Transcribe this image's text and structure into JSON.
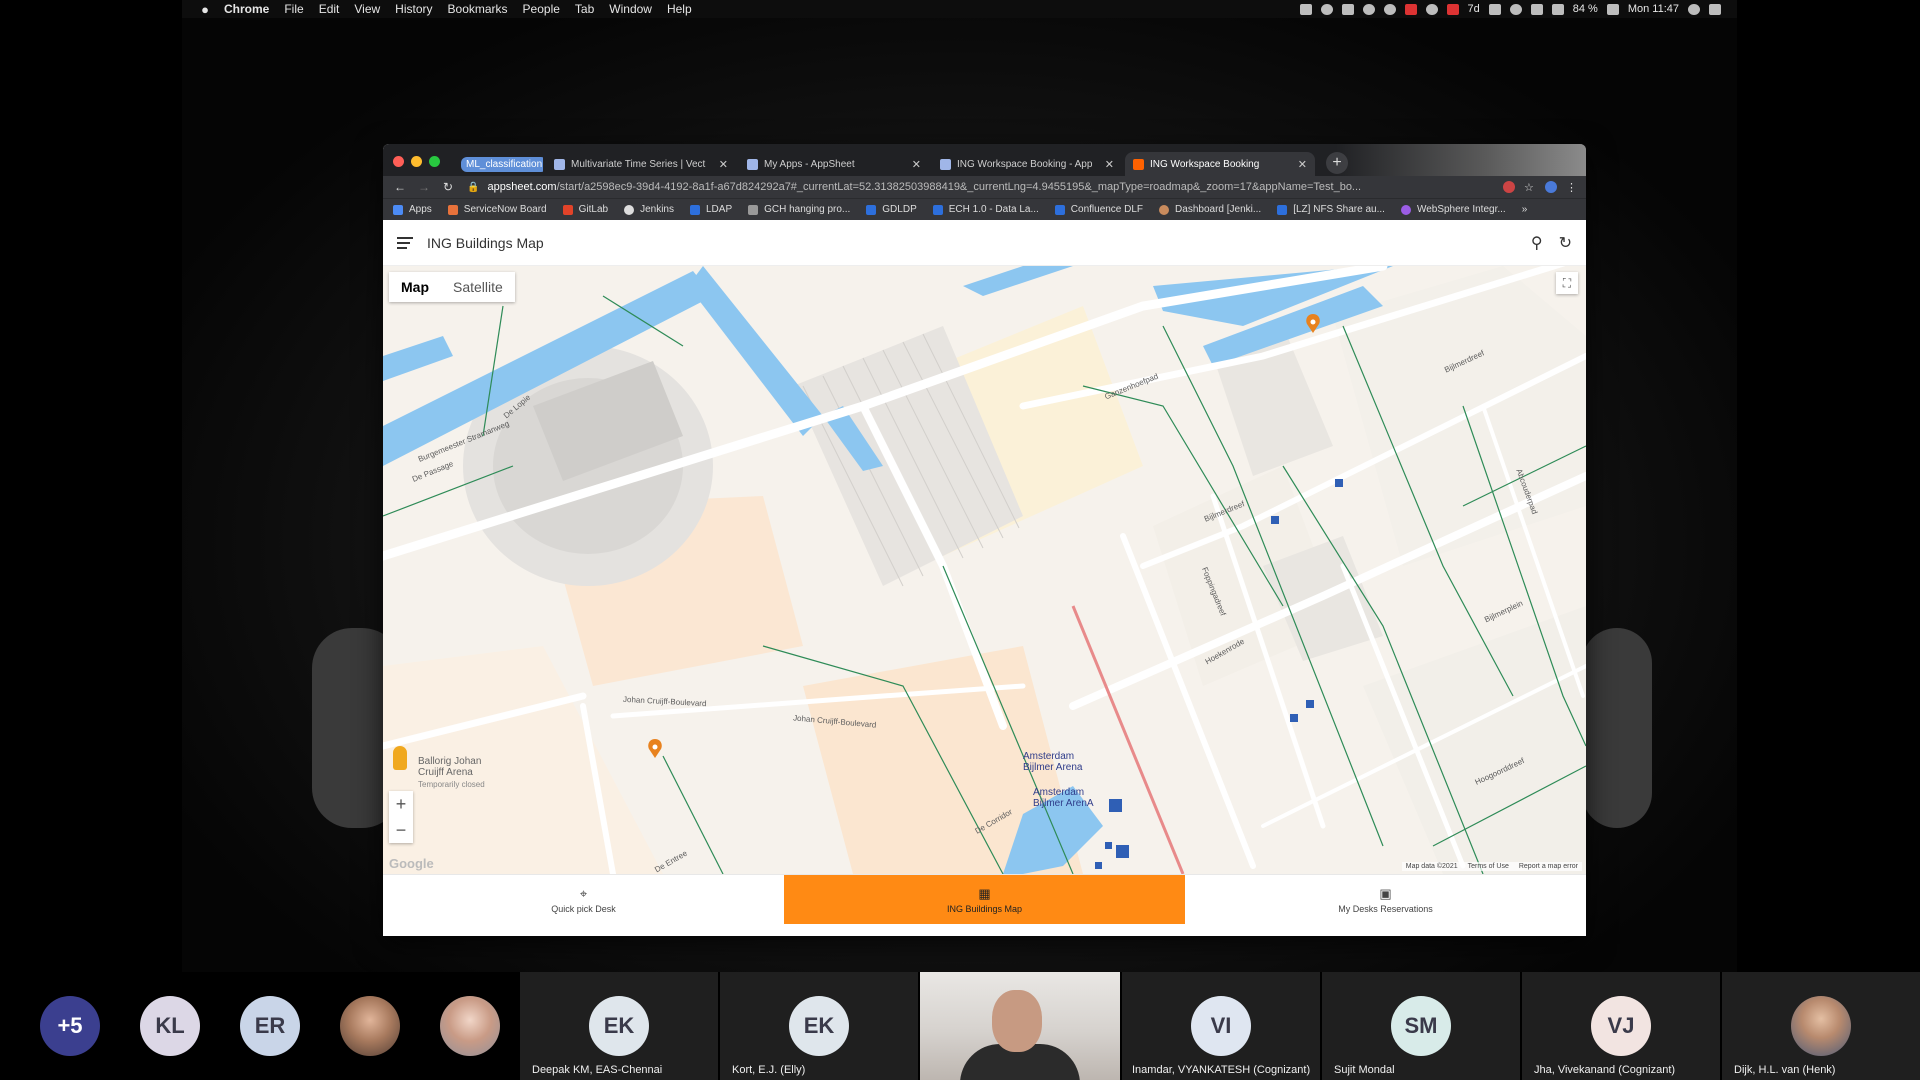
{
  "menubar": {
    "app": "Chrome",
    "items": [
      "File",
      "Edit",
      "View",
      "History",
      "Bookmarks",
      "People",
      "Tab",
      "Window",
      "Help"
    ],
    "status": {
      "weather": "7d",
      "battery": "84 %",
      "clock": "Mon 11:47"
    }
  },
  "browser": {
    "tabs": [
      {
        "label": "ML_classification"
      },
      {
        "label": "Multivariate Time Series | Vect"
      },
      {
        "label": "My Apps - AppSheet"
      },
      {
        "label": "ING Workspace Booking - App"
      },
      {
        "label": "ING Workspace Booking"
      }
    ],
    "url_host": "appsheet.com",
    "url_path": "/start/a2598ec9-39d4-4192-8a1f-a67d824292a7#_currentLat=52.31382503988419&_currentLng=4.9455195&_mapType=roadmap&_zoom=17&appName=Test_bo...",
    "bookmarks": [
      "Apps",
      "ServiceNow Board",
      "GitLab",
      "Jenkins",
      "LDAP",
      "GCH hanging pro...",
      "GDLDP",
      "ECH 1.0 - Data La...",
      "Confluence DLF",
      "Dashboard [Jenki...",
      "[LZ] NFS Share au...",
      "WebSphere Integr...",
      "»"
    ]
  },
  "app": {
    "title": "ING Buildings Map",
    "map": {
      "type_buttons": [
        "Map",
        "Satellite"
      ],
      "labels": {
        "arena": "Amsterdam Bijlmer Arena",
        "station": "Amsterdam Bijlmer ArenA",
        "ballorig": "Ballorig Johan Cruijff Arena",
        "ballorig_status": "Temporarily closed",
        "streets": [
          "Burgemeester Stramanweg",
          "De Passage",
          "De Lopie",
          "Johan Cruijff-Boulevard",
          "Johan Cruijff-Boulevard",
          "Ganzenhoefpad",
          "Bijlmerdreef",
          "Bijlmerdreef",
          "Hoekenrode",
          "Foppingadreef",
          "Bijlmerplein",
          "Hoogoorddreef",
          "De Corridor",
          "De Entree",
          "Abcouderpad"
        ]
      },
      "footer": [
        "Map data ©2021",
        "Terms of Use",
        "Report a map error"
      ],
      "watermark": "Google"
    },
    "nav": [
      {
        "label": "Quick pick Desk",
        "icon": "crosshair-icon"
      },
      {
        "label": "ING Buildings Map",
        "icon": "building-icon"
      },
      {
        "label": "My Desks Reservations",
        "icon": "calendar-icon"
      }
    ]
  },
  "participants": [
    {
      "initials": "+5",
      "color": "#3b3f8f"
    },
    {
      "initials": "KL",
      "color": "#dcd7e6"
    },
    {
      "initials": "ER",
      "color": "#c9d5e8"
    },
    {
      "initials": "EK",
      "name": "Deepak KM, EAS-Chennai",
      "color": "#dfe6ec"
    },
    {
      "initials": "EK",
      "name": "Kort, E.J. (Elly)",
      "color": "#dfe6ec"
    },
    {
      "initials": "VI",
      "name": "Inamdar, VYANKATESH (Cognizant)",
      "color": "#dfe6f1"
    },
    {
      "initials": "SM",
      "name": "Sujit Mondal",
      "color": "#d8ebe9"
    },
    {
      "initials": "VJ",
      "name": "Jha, Vivekanand (Cognizant)",
      "color": "#f2e4e1"
    },
    {
      "name": "Dijk, H.L. van (Henk)"
    }
  ],
  "colors": {
    "accent": "#ff8a14",
    "water": "#8cc6f0",
    "road": "#ffffff",
    "transit": "#e88a8a"
  }
}
